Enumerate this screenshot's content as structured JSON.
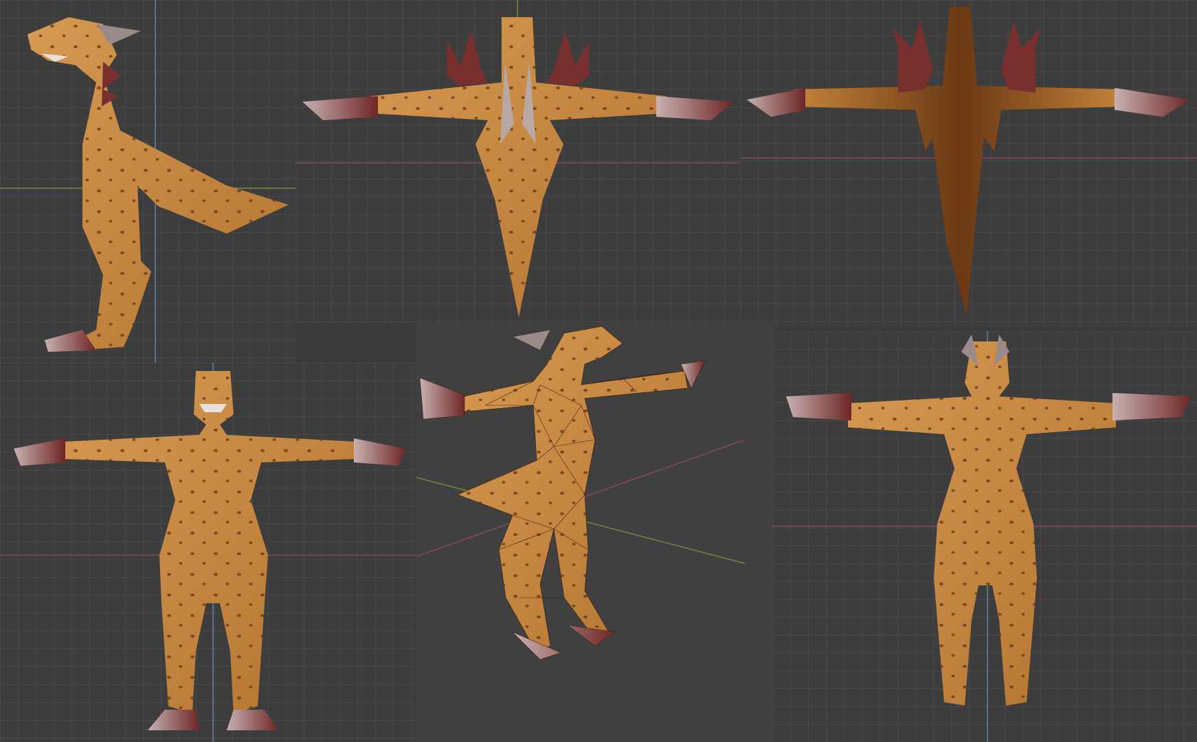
{
  "colors": {
    "skin": "#c98a42",
    "skin_dark": "#8a5422",
    "spots": "#6e3a1c",
    "claws": "#7a2f2f",
    "claw_tip": "#c9b4b4",
    "axis_x": "#8a4a55",
    "axis_y": "#6f8c3c",
    "axis_z": "#5e86a8"
  },
  "viewports": [
    {
      "id": "side",
      "shading": "solid"
    },
    {
      "id": "top",
      "shading": "solid"
    },
    {
      "id": "bottom",
      "shading": "solid"
    },
    {
      "id": "front",
      "shading": "solid"
    },
    {
      "id": "perspective",
      "shading": "solid-wireframe"
    },
    {
      "id": "back",
      "shading": "solid"
    }
  ]
}
